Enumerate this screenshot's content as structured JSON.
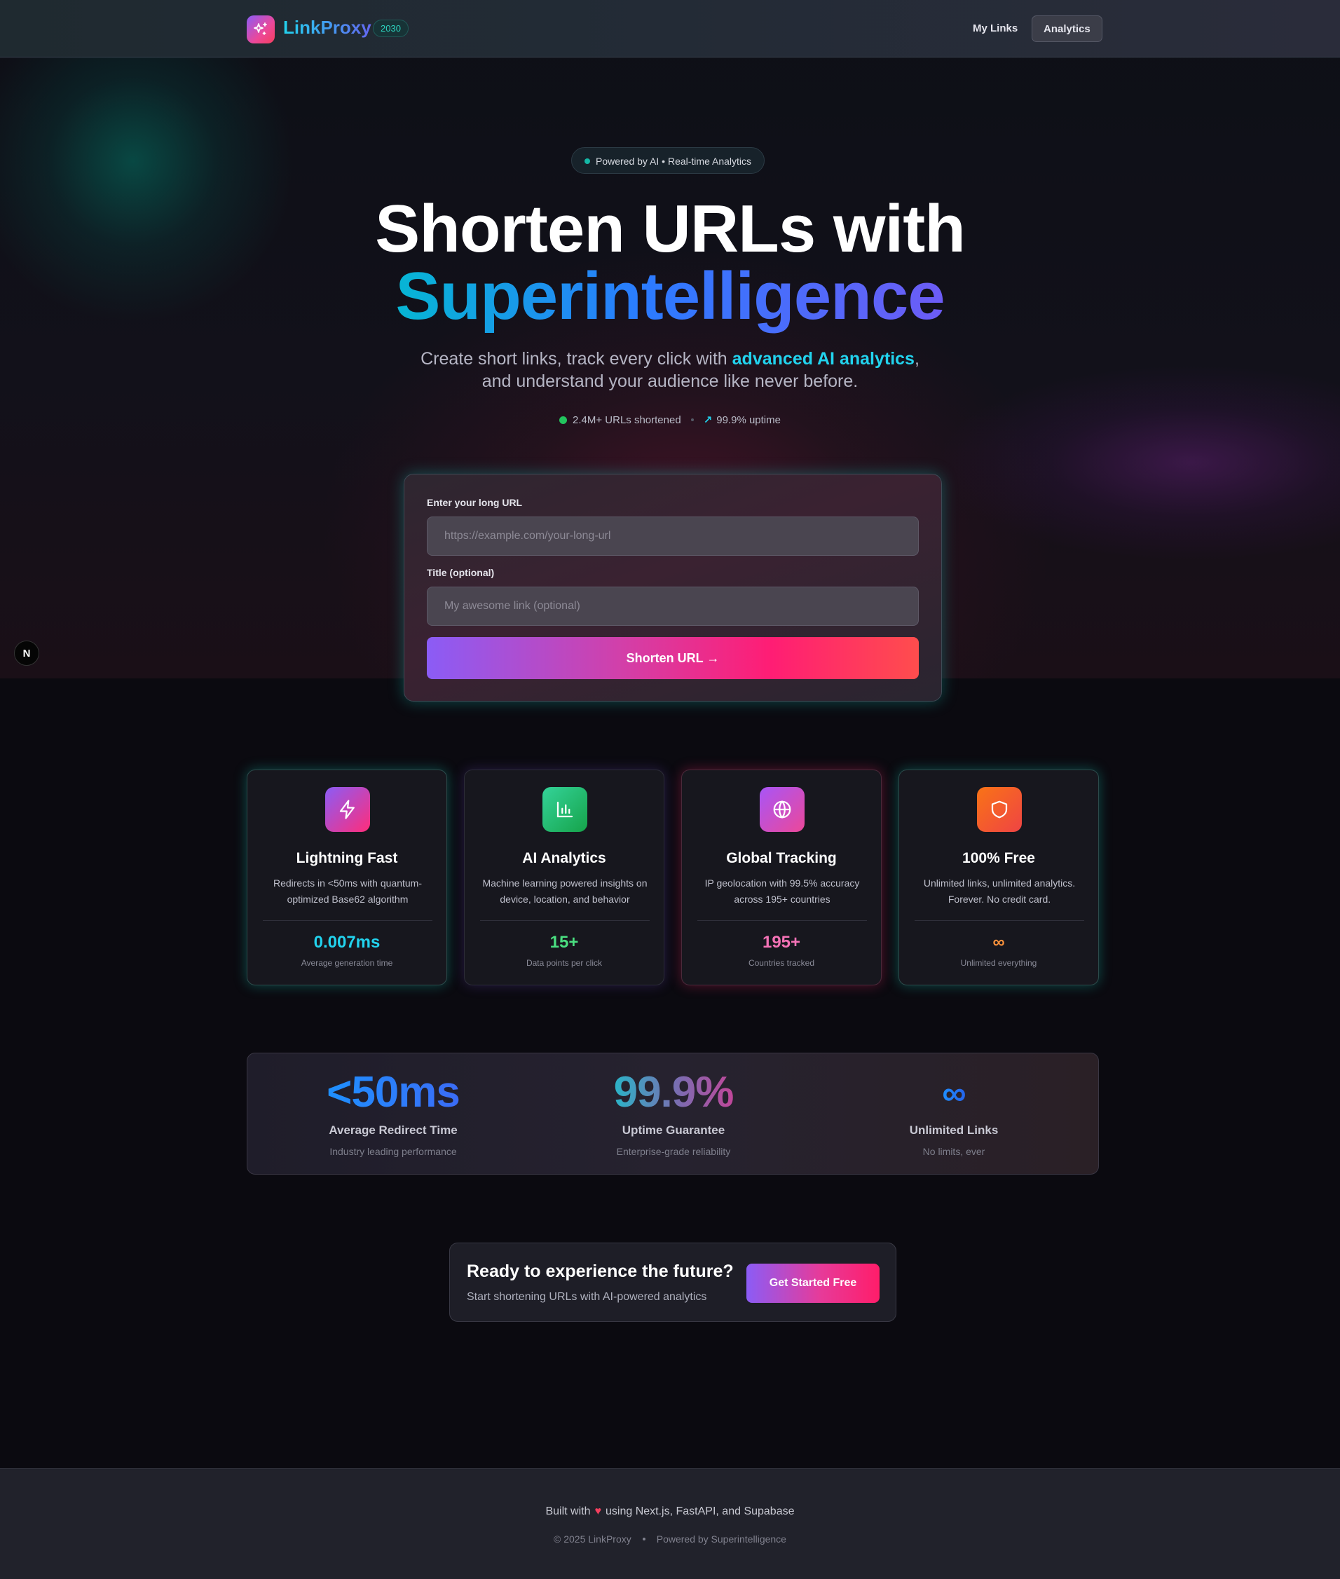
{
  "nav": {
    "brand": "LinkProxy",
    "badge": "2030",
    "links": [
      "My Links",
      "Analytics"
    ]
  },
  "hero": {
    "pill": "Powered by AI • Real-time Analytics",
    "title_line1": "Shorten URLs with",
    "title_line2": "Superintelligence",
    "subtitle_pre": "Create short links, track every click with ",
    "subtitle_highlight": "advanced AI analytics",
    "subtitle_post": ",",
    "subtitle_line2": "and understand your audience like never before.",
    "stat_urls": "2.4M+ URLs shortened",
    "stat_uptime": "99.9% uptime"
  },
  "form": {
    "url_label": "Enter your long URL",
    "url_placeholder": "https://example.com/your-long-url",
    "url_value": "",
    "title_label": "Title (optional)",
    "title_placeholder": "My awesome link (optional)",
    "title_value": "",
    "submit_label": "Shorten URL →"
  },
  "features": [
    {
      "icon": "lightning-icon",
      "title": "Lightning Fast",
      "desc": "Redirects in <50ms with quantum-optimized Base62 algorithm",
      "metric": "0.007ms",
      "metric_label": "Average generation time",
      "color": "#22d3ee"
    },
    {
      "icon": "bar-chart-icon",
      "title": "AI Analytics",
      "desc": "Machine learning powered insights on device, location, and behavior",
      "metric": "15+",
      "metric_label": "Data points per click",
      "color": "#4ade80"
    },
    {
      "icon": "globe-icon",
      "title": "Global Tracking",
      "desc": "IP geolocation with 99.5% accuracy across 195+ countries",
      "metric": "195+",
      "metric_label": "Countries tracked",
      "color": "#f472b6"
    },
    {
      "icon": "shield-icon",
      "title": "100% Free",
      "desc": "Unlimited links, unlimited analytics. Forever. No credit card.",
      "metric": "∞",
      "metric_label": "Unlimited everything",
      "color": "#fb923c"
    }
  ],
  "big_stats": [
    {
      "value": "<50ms",
      "title": "Average Redirect Time",
      "sub": "Industry leading performance"
    },
    {
      "value": "99.9%",
      "title": "Uptime Guarantee",
      "sub": "Enterprise-grade reliability"
    },
    {
      "value": "∞",
      "title": "Unlimited Links",
      "sub": "No limits, ever"
    }
  ],
  "cta": {
    "title": "Ready to experience the future?",
    "sub": "Start shortening URLs with AI-powered analytics",
    "button": "Get Started Free"
  },
  "footer": {
    "line1_pre": "Built with",
    "heart": "♥",
    "line1_post": "using Next.js, FastAPI, and Supabase",
    "copyright": "© 2025 LinkProxy",
    "powered": "Powered by Superintelligence"
  },
  "dev_badge": "N"
}
